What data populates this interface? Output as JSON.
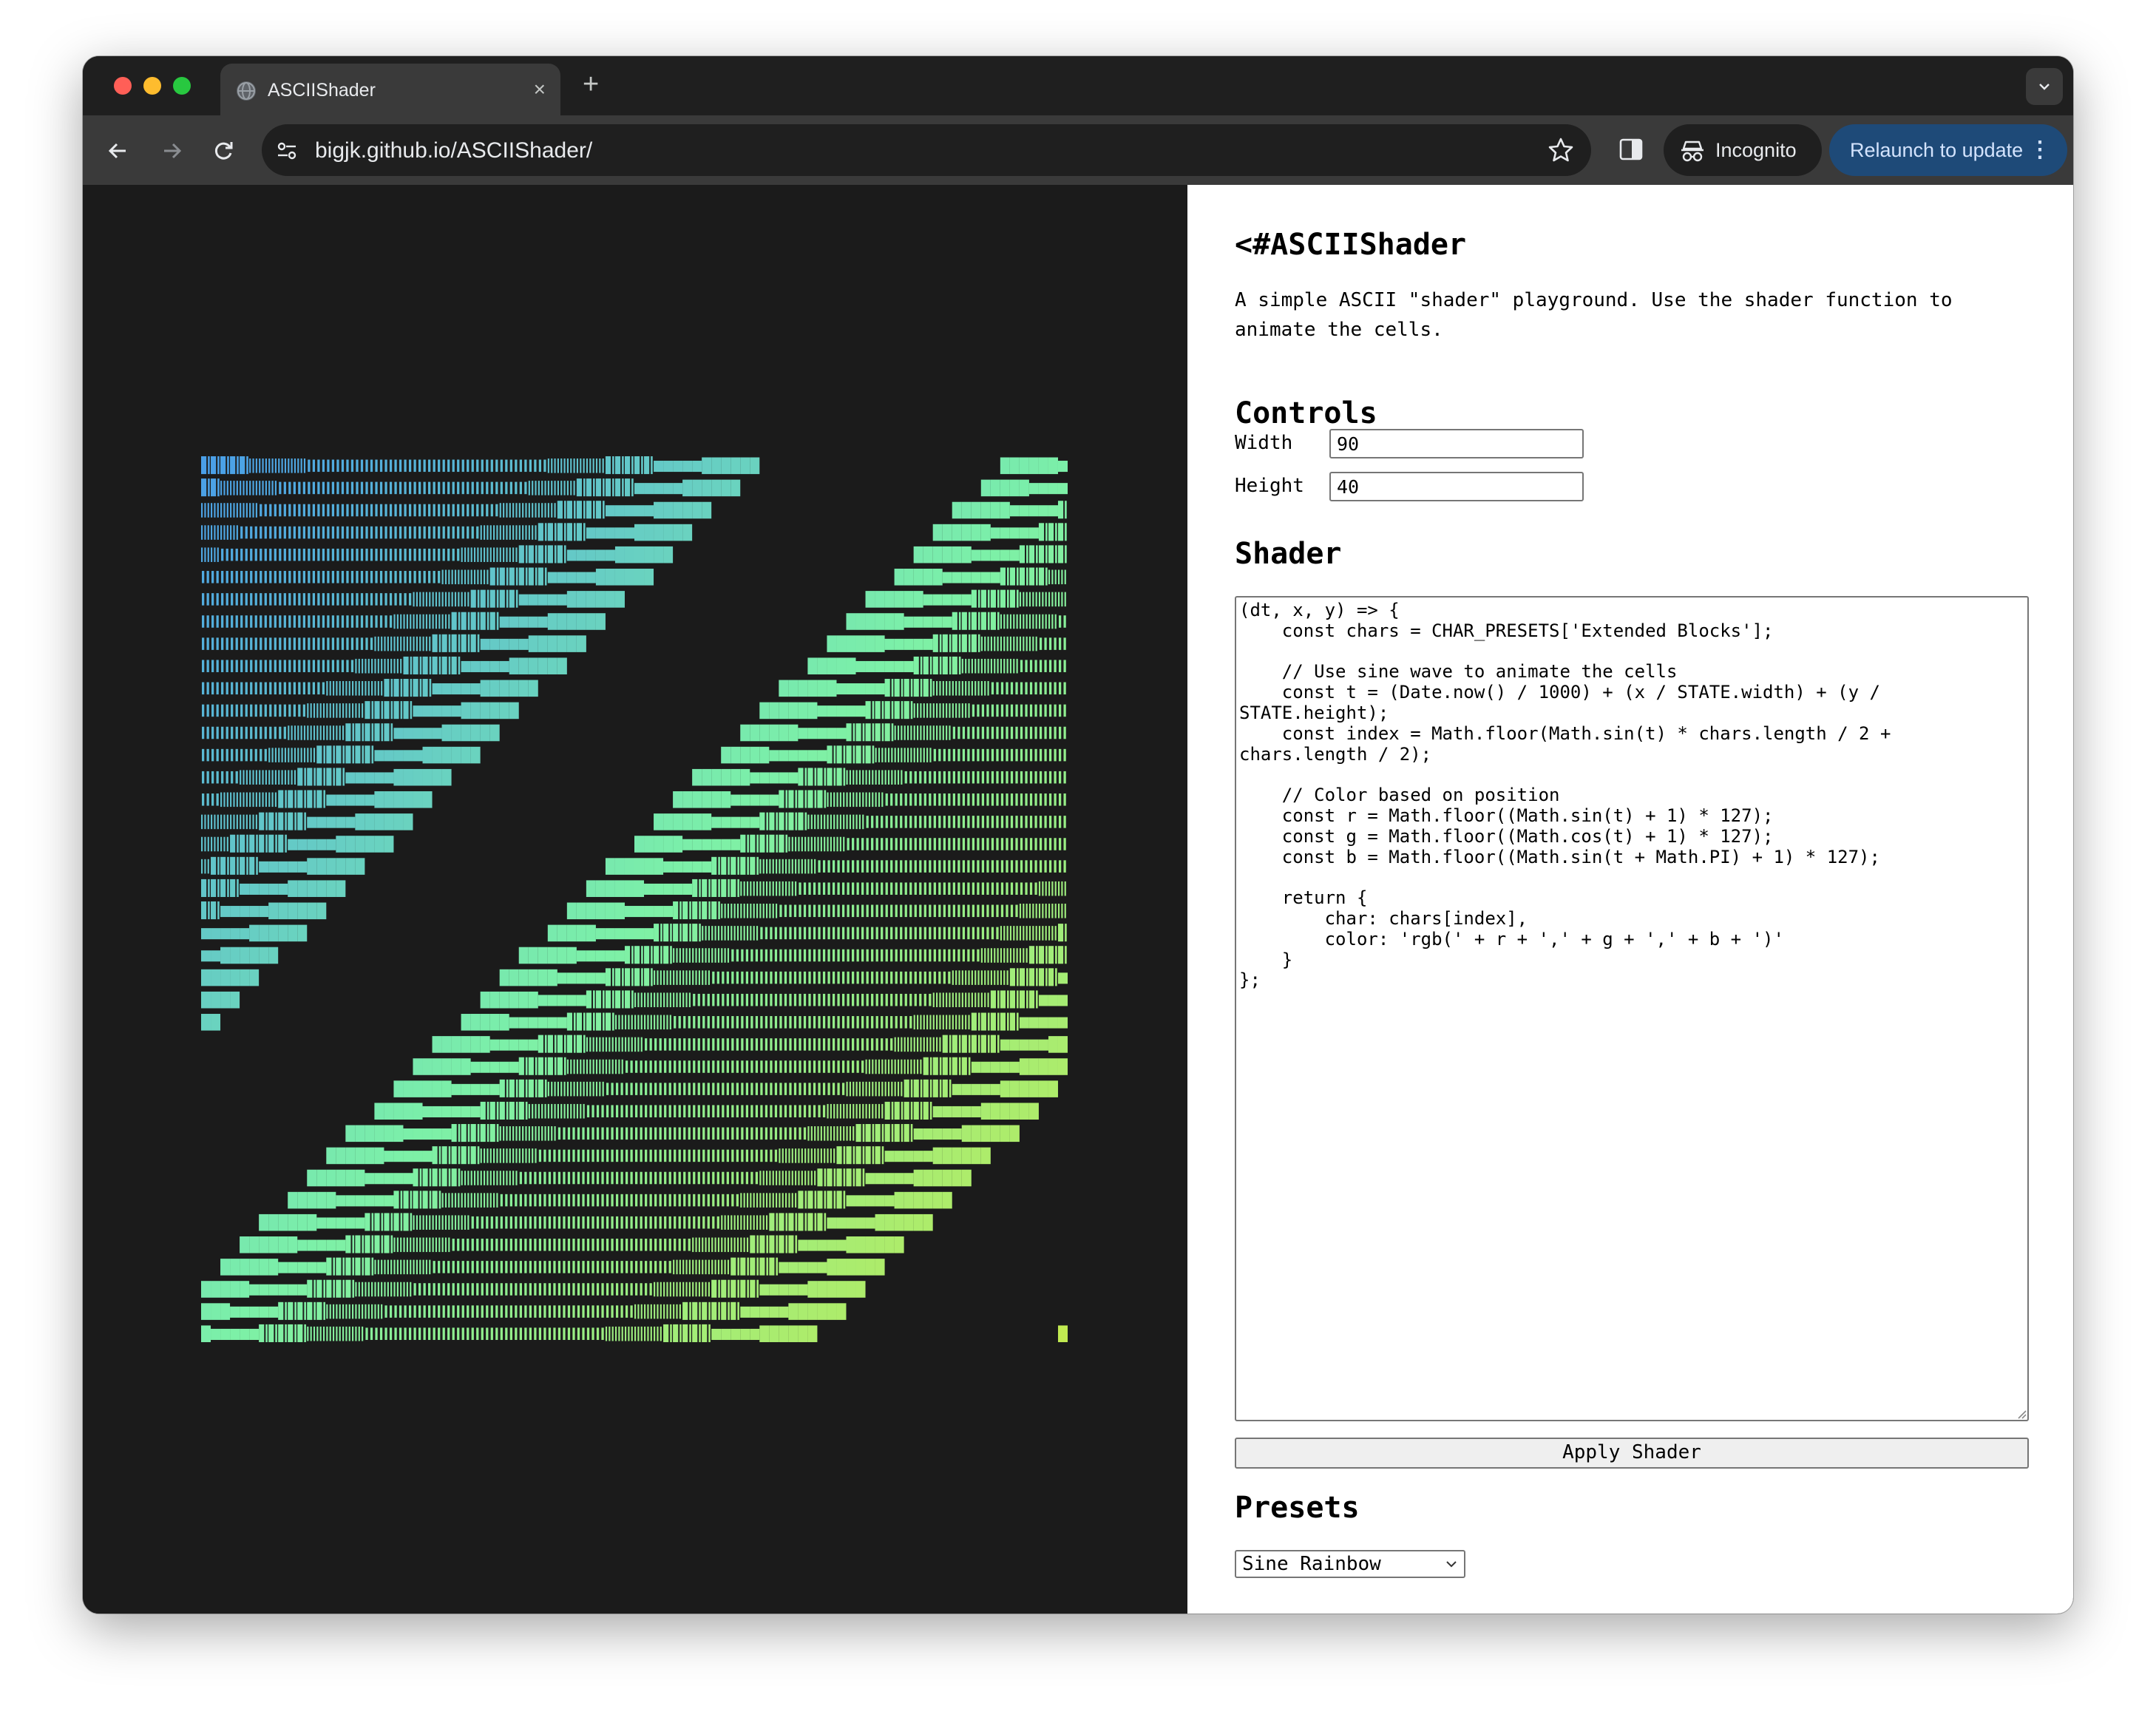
{
  "browser": {
    "tab_title": "ASCIIShader",
    "tab_close": "×",
    "new_tab": "+",
    "url": "bigjk.github.io/ASCIIShader/",
    "incognito_label": "Incognito",
    "relaunch_label": "Relaunch to update",
    "relaunch_menu": "⋮"
  },
  "app": {
    "title": "<#ASCIIShader",
    "description": "A simple ASCII \"shader\" playground. Use the shader function to animate the cells.",
    "controls_heading": "Controls",
    "width_label": "Width",
    "width_value": "90",
    "height_label": "Height",
    "height_value": "40",
    "shader_heading": "Shader",
    "shader_code": "(dt, x, y) => {\n    const chars = CHAR_PRESETS['Extended Blocks'];\n\n    // Use sine wave to animate the cells\n    const t = (Date.now() / 1000) + (x / STATE.width) + (y / STATE.height);\n    const index = Math.floor(Math.sin(t) * chars.length / 2 + chars.length / 2);\n\n    // Color based on position\n    const r = Math.floor((Math.sin(t) + 1) * 127);\n    const g = Math.floor((Math.cos(t) + 1) * 127);\n    const b = Math.floor((Math.sin(t + Math.PI) + 1) * 127);\n\n    return {\n        char: chars[index],\n        color: 'rgb(' + r + ',' + g + ',' + b + ')'\n    }\n};",
    "apply_button": "Apply Shader",
    "presets_heading": "Presets",
    "preset_selected": "Sine Rainbow"
  },
  "canvas": {
    "columns": 90,
    "rows": 40,
    "color_start": "#4a9fe8",
    "color_mid": "#7cf0a8",
    "color_end": "#c4ea4e",
    "background": "#1b1b1b"
  }
}
